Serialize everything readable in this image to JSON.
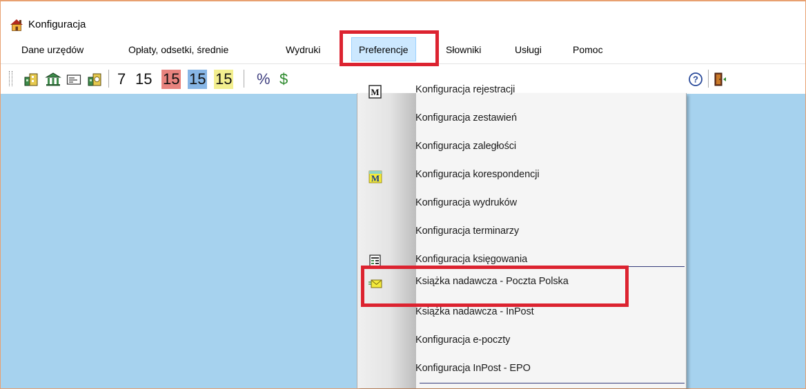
{
  "window": {
    "title": "Konfiguracja"
  },
  "menubar": {
    "items": [
      {
        "label": "Dane urzędów"
      },
      {
        "label": "Opłaty, odsetki, średnie"
      },
      {
        "label": "Wydruki"
      },
      {
        "label": "Preferencje"
      },
      {
        "label": "Słowniki"
      },
      {
        "label": "Usługi"
      },
      {
        "label": "Pomoc"
      }
    ]
  },
  "toolbar": {
    "numbers": [
      {
        "label": "7"
      },
      {
        "label": "15"
      },
      {
        "label": "15",
        "bg": "#e8837e"
      },
      {
        "label": "15",
        "bg": "#87b6e6"
      },
      {
        "label": "15",
        "bg": "#f3ef8f"
      }
    ],
    "percent": "%",
    "dollar": "$"
  },
  "dropdown": {
    "items": [
      {
        "label": "Konfiguracja rejestracji",
        "icon": "letter-m-icon"
      },
      {
        "label": "Konfiguracja zestawień"
      },
      {
        "label": "Konfiguracja zaległości"
      },
      {
        "label": "Konfiguracja korespondencji",
        "icon": "yellow-m-icon"
      },
      {
        "label": "Konfiguracja wydruków"
      },
      {
        "label": "Konfiguracja terminarzy"
      },
      {
        "label": "Konfiguracja księgowania",
        "icon": "ledger-icon"
      },
      {
        "label": "Książka nadawcza - Poczta Polska",
        "icon": "envelope-icon"
      },
      {
        "label": "Książka nadawcza - InPost"
      },
      {
        "label": "Konfiguracja e-poczty"
      },
      {
        "label": "Konfiguracja InPost - EPO"
      }
    ]
  },
  "colors": {
    "highlight": "#dc2330",
    "workspace": "#a6d2ee",
    "menu_active": "#cce8ff"
  }
}
